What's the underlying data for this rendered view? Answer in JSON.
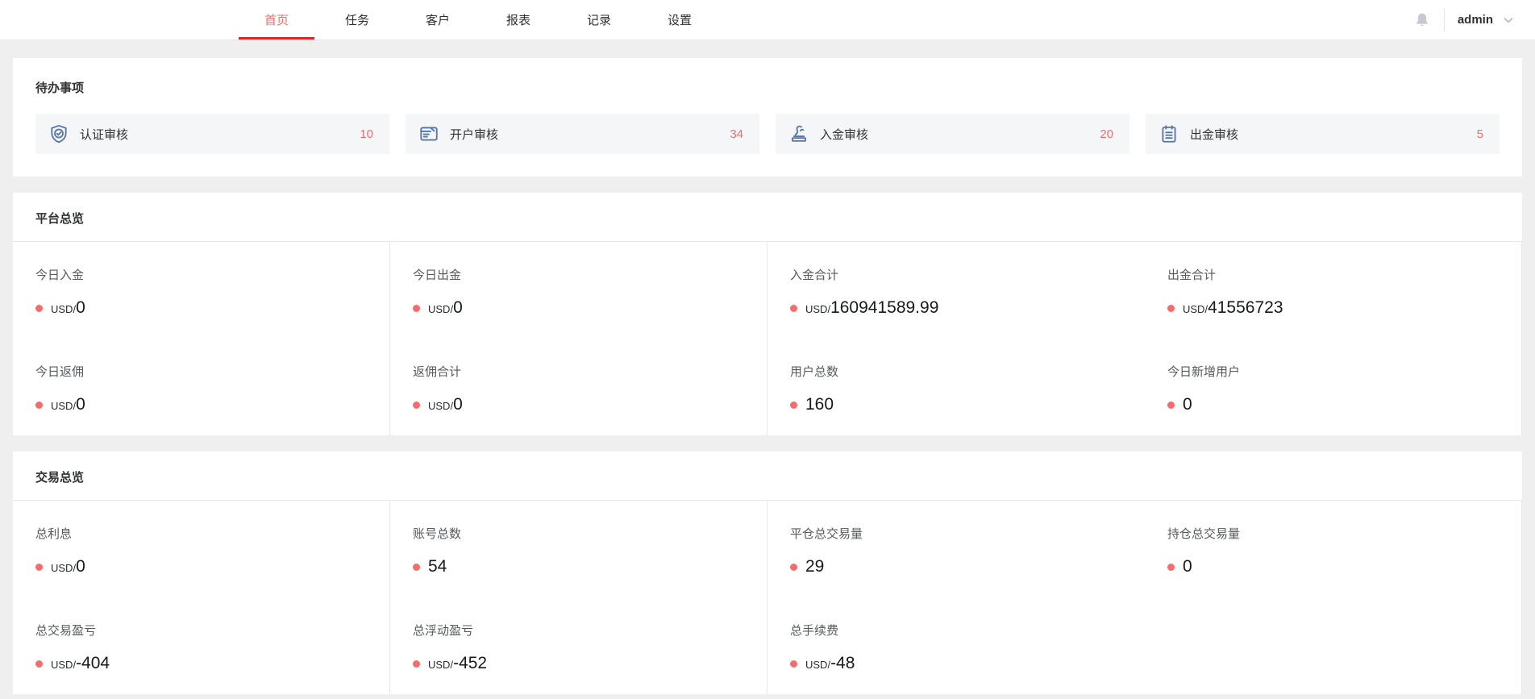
{
  "header": {
    "tabs": [
      {
        "label": "首页",
        "cls": "active"
      },
      {
        "label": "任务",
        "cls": ""
      },
      {
        "label": "客户",
        "cls": ""
      },
      {
        "label": "报表",
        "cls": ""
      },
      {
        "label": "记录",
        "cls": ""
      },
      {
        "label": "设置",
        "cls": ""
      }
    ],
    "icons": [
      "bell-icon",
      "chevron-down-icon"
    ],
    "user": "admin"
  },
  "todo": {
    "title": "待办事项",
    "items": [
      {
        "icon": "shield-check-icon",
        "label": "认证审核",
        "count": "10"
      },
      {
        "icon": "id-card-icon",
        "label": "开户审核",
        "count": "34"
      },
      {
        "icon": "stamp-icon",
        "label": "入金审核",
        "count": "20"
      },
      {
        "icon": "clipboard-icon",
        "label": "出金审核",
        "count": "5"
      }
    ]
  },
  "platform": {
    "title": "平台总览",
    "stats": [
      {
        "label": "今日入金",
        "unit": "USD/",
        "value": "0",
        "cls": ""
      },
      {
        "label": "今日出金",
        "unit": "USD/",
        "value": "0",
        "cls": ""
      },
      {
        "label": "入金合计",
        "unit": "USD/",
        "value": "160941589.99",
        "cls": ""
      },
      {
        "label": "出金合计",
        "unit": "USD/",
        "value": "41556723",
        "cls": ""
      },
      {
        "label": "今日返佣",
        "unit": "USD/",
        "value": "0",
        "cls": ""
      },
      {
        "label": "返佣合计",
        "unit": "USD/",
        "value": "0",
        "cls": ""
      },
      {
        "label": "用户总数",
        "unit": "",
        "value": "160",
        "cls": ""
      },
      {
        "label": "今日新增用户",
        "unit": "",
        "value": "0",
        "cls": ""
      }
    ]
  },
  "trade": {
    "title": "交易总览",
    "stats": [
      {
        "label": "总利息",
        "unit": "USD/",
        "value": "0",
        "cls": ""
      },
      {
        "label": "账号总数",
        "unit": "",
        "value": "54",
        "cls": ""
      },
      {
        "label": "平仓总交易量",
        "unit": "",
        "value": "29",
        "cls": ""
      },
      {
        "label": "持仓总交易量",
        "unit": "",
        "value": "0",
        "cls": ""
      },
      {
        "label": "总交易盈亏",
        "unit": "USD/",
        "value": "-404",
        "cls": ""
      },
      {
        "label": "总浮动盈亏",
        "unit": "USD/",
        "value": "-452",
        "cls": ""
      },
      {
        "label": "总手续费",
        "unit": "USD/",
        "value": "-48",
        "cls": ""
      },
      {
        "label": "",
        "unit": "",
        "value": "",
        "cls": "empty"
      }
    ]
  },
  "colors": {
    "accent_red": "#f56c6c",
    "tab_underline_red": "#e0262d",
    "icon_blue": "#5677a6",
    "page_bg": "#efefef",
    "card_bg": "#f5f6f7"
  }
}
